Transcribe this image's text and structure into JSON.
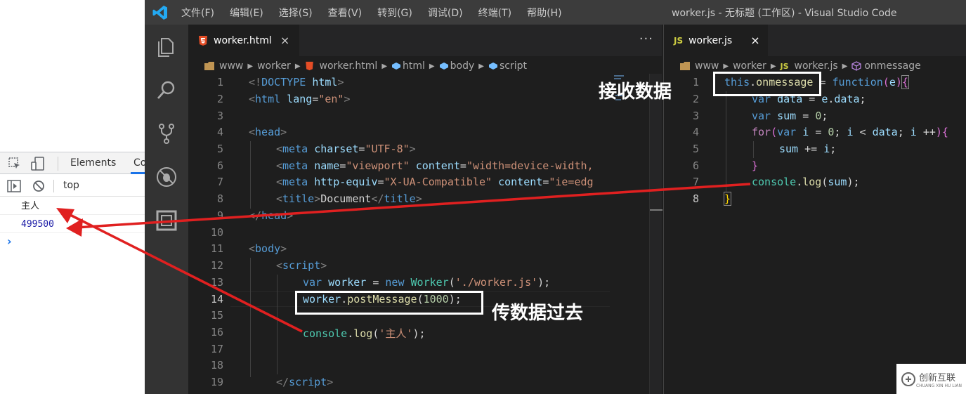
{
  "devtools": {
    "tabs": [
      "Elements",
      "Co"
    ],
    "context": "top",
    "console_logs": [
      "主人",
      "499500"
    ],
    "prompt": "›"
  },
  "vscode": {
    "menu": [
      "文件(F)",
      "编辑(E)",
      "选择(S)",
      "查看(V)",
      "转到(G)",
      "调试(D)",
      "终端(T)",
      "帮助(H)"
    ],
    "window_title": "worker.js - 无标题 (工作区) - Visual Studio Code",
    "left": {
      "tab": {
        "label": "worker.html",
        "close": "×"
      },
      "more": "···",
      "breadcrumb": [
        "www",
        "worker",
        "worker.html",
        "html",
        "body",
        "script"
      ],
      "line_numbers": [
        "1",
        "2",
        "3",
        "4",
        "5",
        "6",
        "7",
        "8",
        "9",
        "10",
        "11",
        "12",
        "13",
        "14",
        "15",
        "16",
        "17",
        "18",
        "19"
      ],
      "current_line": "14"
    },
    "right": {
      "tab": {
        "label": "worker.js",
        "close": "×",
        "badge": "JS"
      },
      "breadcrumb": [
        "www",
        "worker",
        "worker.js",
        "onmessage"
      ],
      "breadcrumb_badge": "JS",
      "line_numbers": [
        "1",
        "2",
        "3",
        "4",
        "5",
        "6",
        "7",
        "8"
      ]
    },
    "colors": {
      "editor_bg": "#1e1e1e",
      "titlebar_bg": "#3c3c3c",
      "activity_bg": "#333333",
      "tabbar_bg": "#252526",
      "html_icon": "#e44d26",
      "js_badge": "#cbcb41",
      "vs_blue": "#23a9f2"
    }
  },
  "annotations": {
    "receive": "接收数据",
    "send": "传数据过去",
    "arrow_color": "#e02020"
  },
  "watermark": {
    "text": "创新互联",
    "sub": "CHUANG XIN HU LIAN"
  }
}
